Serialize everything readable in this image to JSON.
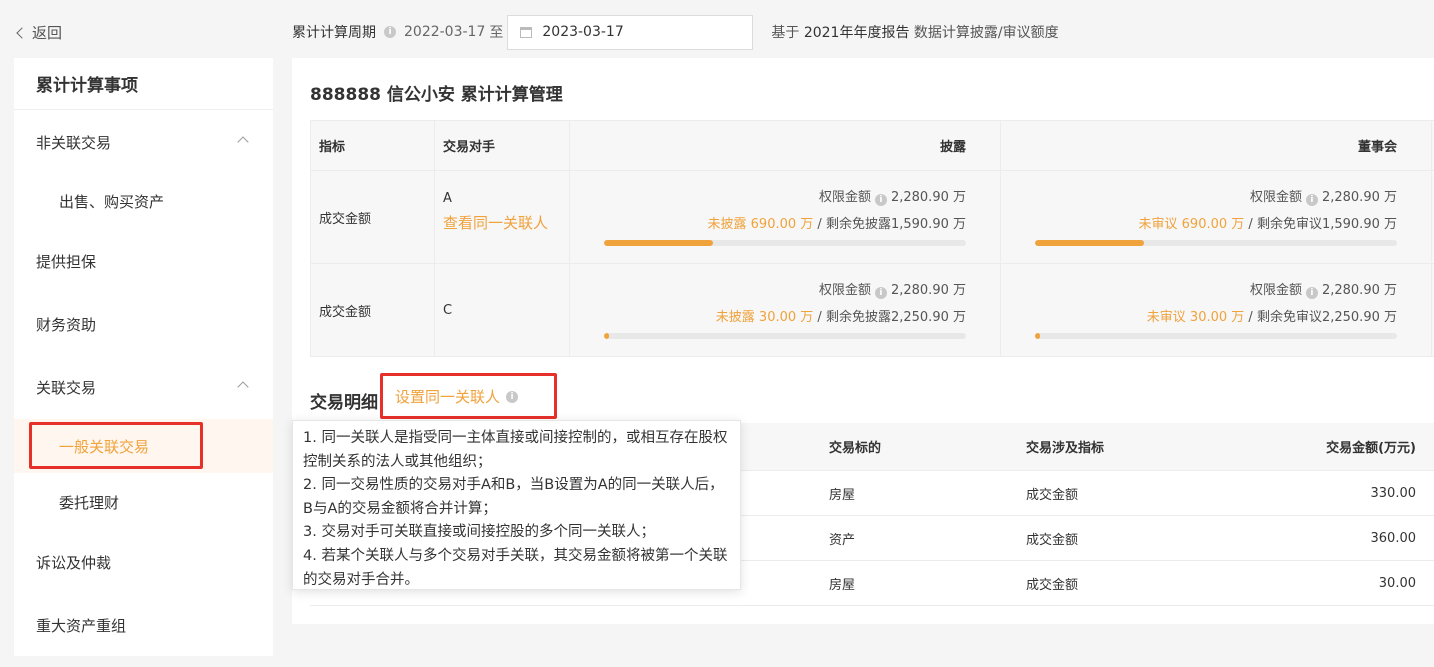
{
  "header": {
    "back_label": "返回",
    "period_label": "累计计算周期",
    "start_date": "2022-03-17",
    "to_label": "至",
    "end_date": "2023-03-17",
    "basis_prefix": "基于",
    "basis_report": "2021年年度报告",
    "basis_suffix": "数据计算披露/审议额度"
  },
  "sidebar": {
    "title": "累计计算事项",
    "items": [
      {
        "label": "非关联交易"
      },
      {
        "label": "出售、购买资产"
      },
      {
        "label": "提供担保"
      },
      {
        "label": "财务资助"
      },
      {
        "label": "关联交易"
      },
      {
        "label": "一般关联交易"
      },
      {
        "label": "委托理财"
      },
      {
        "label": "诉讼及仲裁"
      },
      {
        "label": "重大资产重组"
      }
    ]
  },
  "main": {
    "title": "888888 信公小安 累计计算管理",
    "summary_table": {
      "headers": [
        "指标",
        "交易对手",
        "披露",
        "董事会"
      ],
      "limit_label": "权限金额",
      "rows": [
        {
          "metric": "成交金额",
          "counterparty": "A",
          "link": "查看同一关联人",
          "disclosure": {
            "limit": "2,280.90 万",
            "pending_label": "未披露",
            "pending": "690.00 万",
            "sep": "/",
            "remain_label": "剩余免披露",
            "remain": "1,590.90 万",
            "progress": 0.3
          },
          "board": {
            "limit": "2,280.90 万",
            "pending_label": "未审议",
            "pending": "690.00 万",
            "sep": "/",
            "remain_label": "剩余免审议",
            "remain": "1,590.90 万",
            "progress": 0.3
          }
        },
        {
          "metric": "成交金额",
          "counterparty": "C",
          "disclosure": {
            "limit": "2,280.90 万",
            "pending_label": "未披露",
            "pending": "30.00 万",
            "sep": "/",
            "remain_label": "剩余免披露",
            "remain": "2,250.90 万",
            "progress": 0.013
          },
          "board": {
            "limit": "2,280.90 万",
            "pending_label": "未审议",
            "pending": "30.00 万",
            "sep": "/",
            "remain_label": "剩余免审议",
            "remain": "2,250.90 万",
            "progress": 0.013
          }
        }
      ]
    },
    "detail_title": "交易明细",
    "set_link": "设置同一关联人",
    "detail_table": {
      "headers": [
        "交易标的",
        "交易涉及指标",
        "交易金额(万元)"
      ],
      "rows": [
        [
          "房屋",
          "成交金额",
          "330.00"
        ],
        [
          "资产",
          "成交金额",
          "360.00"
        ],
        [
          "房屋",
          "成交金额",
          "30.00"
        ]
      ]
    }
  },
  "tooltip": {
    "lines": [
      "1. 同一关联人是指受同一主体直接或间接控制的，或相互存在股权控制关系的法人或其他组织；",
      "2. 同一交易性质的交易对手A和B，当B设置为A的同一关联人后，B与A的交易金额将合并计算；",
      "3. 交易对手可关联直接或间接控股的多个同一关联人；",
      "4. 若某个关联人与多个交易对手关联，其交易金额将被第一个关联的交易对手合并。"
    ]
  },
  "colors": {
    "accent": "#f0a23b",
    "highlight": "#e8302a"
  }
}
